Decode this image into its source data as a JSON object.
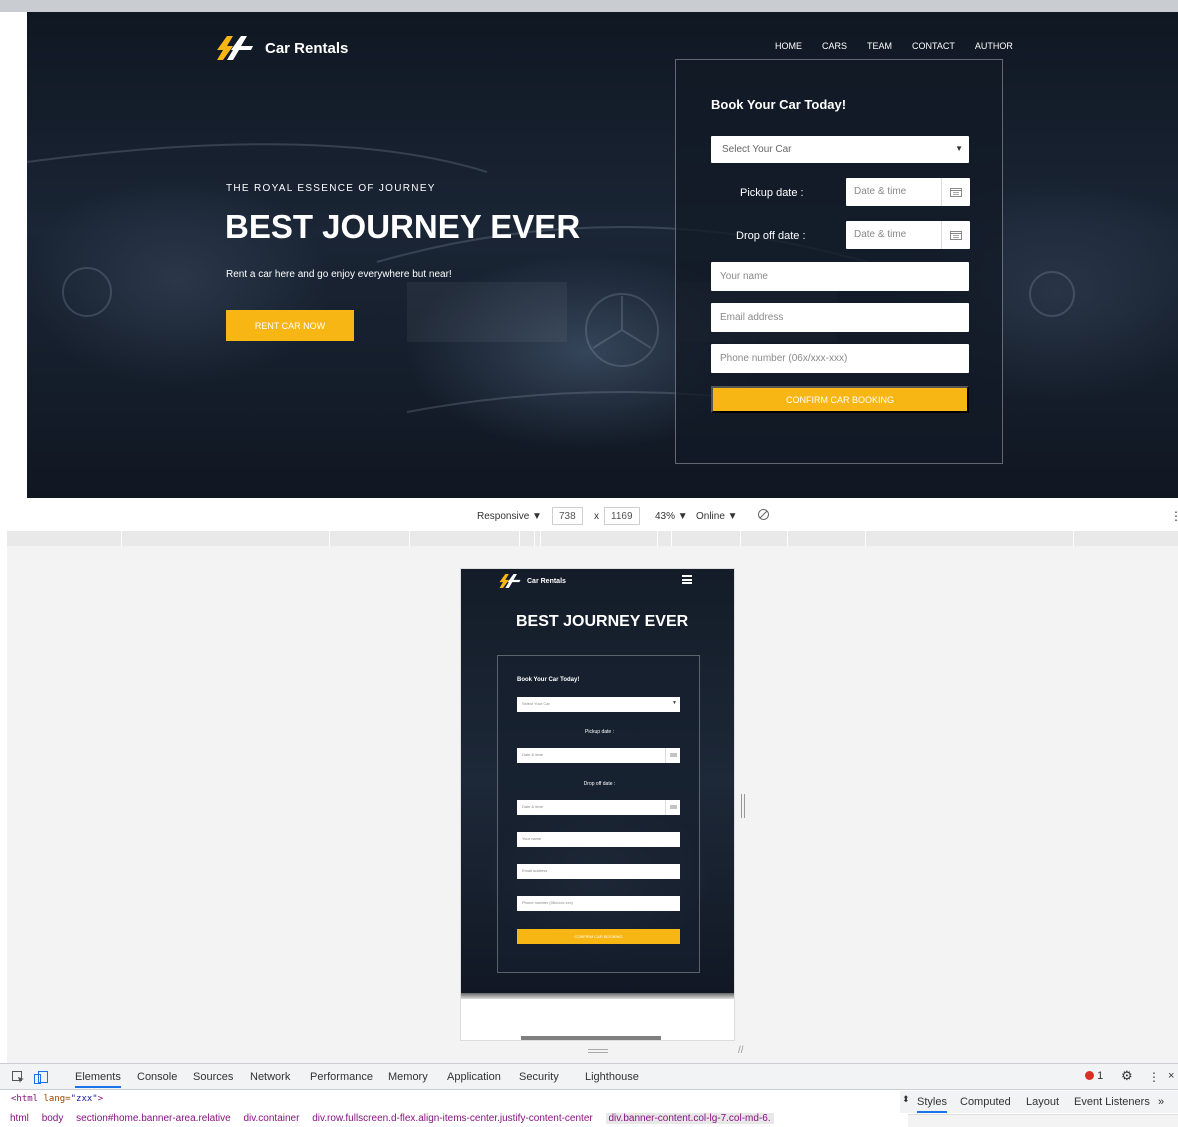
{
  "desktop": {
    "brand": "Car Rentals",
    "nav": [
      "HOME",
      "CARS",
      "TEAM",
      "CONTACT",
      "AUTHOR"
    ],
    "hero": {
      "subtitle": "THE ROYAL ESSENCE OF JOURNEY",
      "title": "BEST JOURNEY EVER",
      "description": "Rent a car here and go enjoy everywhere but near!",
      "cta": "RENT CAR NOW"
    },
    "form": {
      "title": "Book Your Car Today!",
      "select_placeholder": "Select Your Car",
      "pickup_label": "Pickup date :",
      "dropoff_label": "Drop off date :",
      "date_placeholder": "Date & time",
      "name_placeholder": "Your name",
      "email_placeholder": "Email address",
      "phone_placeholder": "Phone number (06x/xxx-xxx)",
      "confirm": "CONFIRM CAR BOOKING"
    }
  },
  "device_toolbar": {
    "mode": "Responsive",
    "width": "738",
    "x_sep": "x",
    "height": "1169",
    "zoom": "43%",
    "network": "Online"
  },
  "mobile": {
    "brand": "Car Rentals",
    "title": "BEST JOURNEY EVER",
    "form": {
      "title": "Book Your Car Today!",
      "select_placeholder": "Select Your Car",
      "pickup_label": "Pickup date :",
      "dropoff_label": "Drop off date :",
      "date_placeholder": "Date & time",
      "name_placeholder": "Your name",
      "email_placeholder": "Email address",
      "phone_placeholder": "Phone number (06x/xxx-xxx)",
      "confirm": "CONFIRM CAR BOOKING"
    }
  },
  "devtools": {
    "tabs": [
      "Elements",
      "Console",
      "Sources",
      "Network",
      "Performance",
      "Memory",
      "Application",
      "Security",
      "Lighthouse"
    ],
    "error_count": "1",
    "dom_tag": "<html",
    "dom_attr": " lang=",
    "dom_val": "\"zxx\"",
    "dom_close": ">",
    "styles_tabs": [
      "Styles",
      "Computed",
      "Layout",
      "Event Listeners"
    ],
    "more": "»",
    "breadcrumbs": [
      "html",
      "body",
      "section#home.banner-area.relative",
      "div.container",
      "div.row.fullscreen.d-flex.align-items-center.justify-content-center",
      "div.banner-content.col-lg-7.col-md-6."
    ]
  },
  "colors": {
    "accent": "#f7b614",
    "hero_dark": "#1a2535",
    "devtools_blue": "#1a73e8",
    "error_red": "#d93025"
  }
}
